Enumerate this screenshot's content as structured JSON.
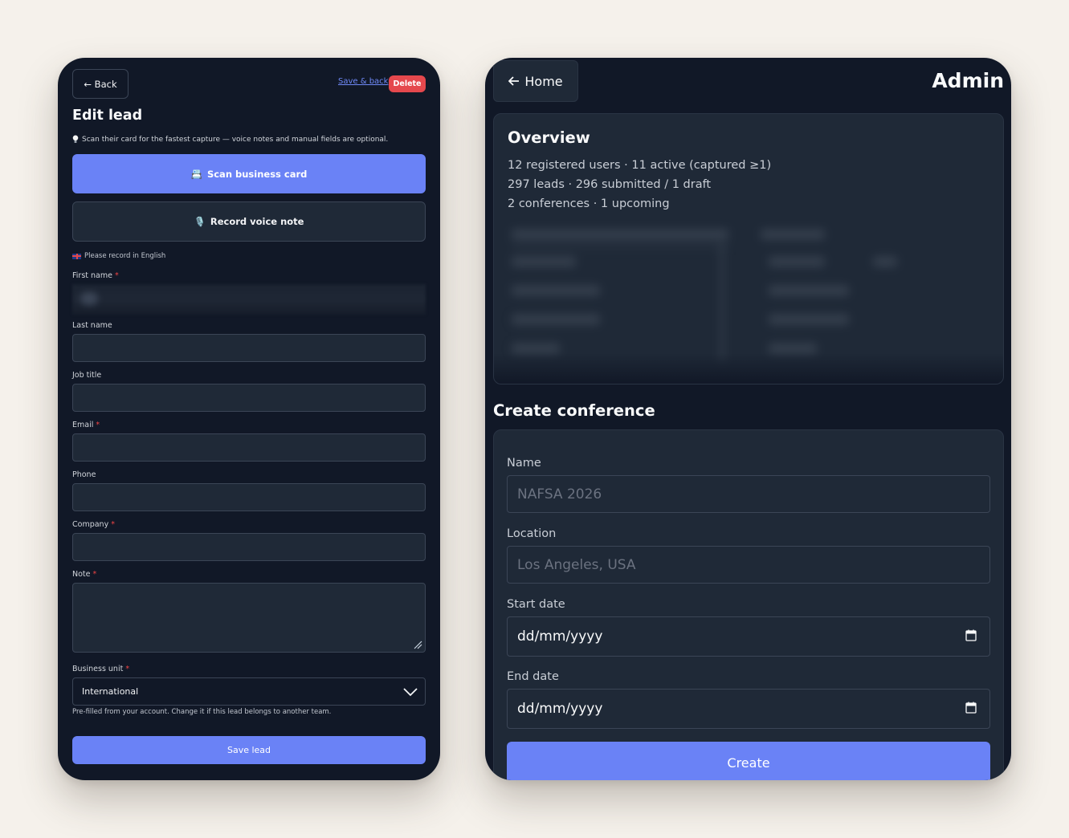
{
  "edit_lead": {
    "back_label": "← Back",
    "save_back_label": "Save & back",
    "delete_label": "Delete",
    "title": "Edit lead",
    "tip": "Scan their card for the fastest capture — voice notes and manual fields are optional.",
    "scan_icon": "📇",
    "scan_label": "Scan business card",
    "voice_icon": "🎙️",
    "voice_label": "Record voice note",
    "record_hint": "Please record in English",
    "fields": {
      "first_name": {
        "label": "First name",
        "required": true
      },
      "last_name": {
        "label": "Last name",
        "required": false
      },
      "job_title": {
        "label": "Job title",
        "required": false
      },
      "email": {
        "label": "Email",
        "required": true
      },
      "phone": {
        "label": "Phone",
        "required": false
      },
      "company": {
        "label": "Company",
        "required": true
      },
      "note": {
        "label": "Note",
        "required": true
      },
      "business_unit": {
        "label": "Business unit",
        "required": true,
        "value": "International"
      }
    },
    "required_mark": "*",
    "prefill_hint": "Pre-filled from your account. Change it if this lead belongs to another team.",
    "save_label": "Save lead"
  },
  "admin": {
    "home_label": "Home",
    "title": "Admin",
    "overview": {
      "title": "Overview",
      "lines": [
        "12 registered users · 11 active (captured ≥1)",
        "297 leads · 296 submitted / 1 draft",
        "2 conferences · 1 upcoming"
      ]
    },
    "create_conference": {
      "title": "Create conference",
      "name_label": "Name",
      "name_placeholder": "NAFSA 2026",
      "location_label": "Location",
      "location_placeholder": "Los Angeles, USA",
      "start_label": "Start date",
      "start_value": "dd/mm/yyyy",
      "end_label": "End date",
      "end_value": "dd/mm/yyyy",
      "create_label": "Create"
    }
  },
  "colors": {
    "background": "#f5f1eb",
    "panel": "#111827",
    "card": "#1f2937",
    "accent": "#6a82f6",
    "danger": "#e5484d"
  }
}
